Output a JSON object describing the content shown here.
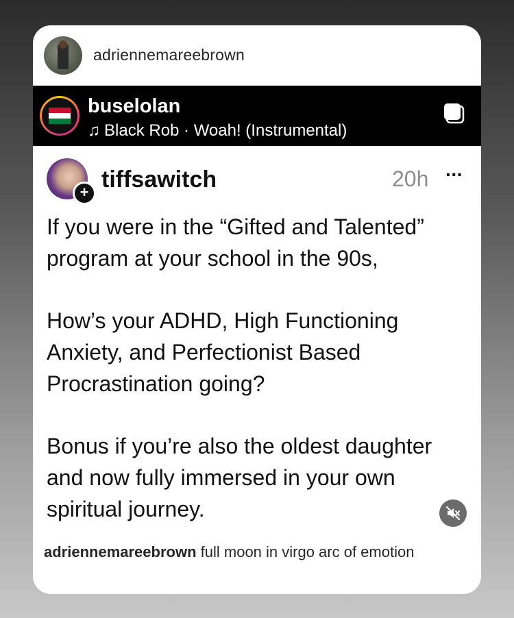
{
  "story": {
    "username": "adriennemareebrown",
    "caption_user": "adriennemareebrown",
    "caption_text": "full moon in virgo arc of emotion"
  },
  "music": {
    "username": "buselolan",
    "note_icon": "♫",
    "track": "Black Rob · Woah! (Instrumental)"
  },
  "post": {
    "username": "tiffsawitch",
    "time": "20h",
    "more": "···",
    "follow_plus": "+",
    "paragraphs": [
      "If you were in the “Gifted and Talented” program at your school in the 90s,",
      "How’s your ADHD, High Functioning Anxiety, and Perfectionist Based Procrastination going?",
      "Bonus if you’re also the oldest daughter and now fully immersed in your own spiritual journey."
    ]
  },
  "icons": {
    "carousel": "carousel-icon",
    "mute": "mute-icon",
    "music_note": "music-note-icon"
  },
  "colors": {
    "music_bar_bg": "#000000",
    "card_bg": "#ffffff",
    "time_color": "#8e8e8e"
  }
}
